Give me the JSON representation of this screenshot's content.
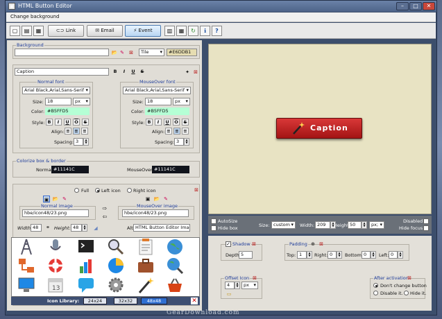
{
  "window": {
    "title": "HTML Button Editor",
    "minimize": "–",
    "maximize": "□",
    "close": "✕"
  },
  "menu": {
    "item": "Change background"
  },
  "toolbar": {
    "link": "Link",
    "email": "Email",
    "event": "Event"
  },
  "background": {
    "legend": "Background",
    "path": "",
    "mode": "Tile",
    "color": "#E6DDB1"
  },
  "caption": {
    "text": "Caption",
    "bold": "B",
    "italic": "I",
    "underline": "U",
    "strike": "S"
  },
  "normal_font": {
    "legend": "Normal font",
    "family": "Arial Black,Arial,Sans-Serif",
    "size_label": "Size:",
    "size": "18",
    "unit": "px",
    "color_label": "Color:",
    "color": "#B5FFD5",
    "style_label": "Style:",
    "align_label": "Align:",
    "spacing_label": "Spacing:",
    "spacing": "3"
  },
  "mouseover_font": {
    "legend": "MouseOver font",
    "family": "Arial Black,Arial,Sans-Serif",
    "size_label": "Size:",
    "size": "18",
    "unit": "px",
    "color_label": "Color:",
    "color": "#B5FFD5",
    "style_label": "Style:",
    "align_label": "Align:",
    "spacing_label": "Spacing:",
    "spacing": "3"
  },
  "colorize": {
    "legend": "Colorize box & border",
    "normal_label": "Normal:",
    "normal": "#11141C",
    "mouseover_label": "MouseOver:",
    "mouseover": "#11141C"
  },
  "icon": {
    "full": "Full",
    "left": "Left icon",
    "right": "Right icon",
    "normal_image_label": "Normal image",
    "normal_image": "hbe/icon48/23.png",
    "mouseover_image_label": "MouseOver image",
    "mouseover_image": "hbe/icon48/23.png",
    "width_label": "Width:",
    "width": "48",
    "height_label": "Height:",
    "height": "48",
    "alt_label": "Alt:",
    "alt": "HTML Button Editor Image"
  },
  "library": {
    "label": "Icon Library:",
    "sizes": [
      "24x24",
      "32x32",
      "48x48"
    ],
    "selected": "48x48"
  },
  "preview": {
    "button_caption": "Caption",
    "bg_color": "#E6DDB1",
    "button_color": "#C62828"
  },
  "controls": {
    "autosize": "AutoSize",
    "hidebox": "Hide box",
    "size_label": "Size:",
    "size": "custom",
    "width_label": "Width:",
    "width": "209",
    "height_label": "Height:",
    "height": "50",
    "unit": "px;",
    "disabled": "Disabled",
    "hidefocus": "Hide focus"
  },
  "shadow": {
    "legend": "Shadow",
    "depth_label": "Depth:",
    "depth": "5"
  },
  "padding": {
    "legend": "Padding",
    "top_label": "Top:",
    "top": "1",
    "right_label": "Right:",
    "right": "0",
    "bottom_label": "Bottom:",
    "bottom": "0",
    "left_label": "Left:",
    "left": "0",
    "unit": "px"
  },
  "offset": {
    "legend": "Offset Icon",
    "value": "4",
    "unit": "px"
  },
  "after": {
    "legend": "After activation",
    "opt1": "Don't change button",
    "opt2": "Disable it.",
    "opt3": "Hide it."
  },
  "watermark": "GearDownload.com"
}
